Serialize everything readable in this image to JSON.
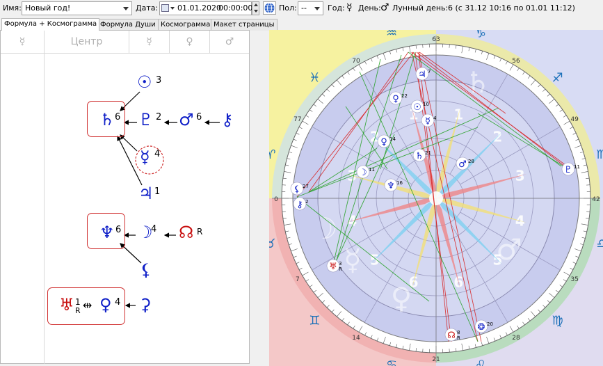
{
  "toolbar": {
    "name_label": "Имя:",
    "name_value": "Новый год!",
    "date_label": "Дата:",
    "date_value": "01.01.2020",
    "time_value": "00:00:00",
    "sex_label": "Пол:",
    "sex_value": "--",
    "year_label": "Год:",
    "year_glyph": "☿",
    "day_label": "День:",
    "day_glyph": "♂",
    "lunar_label": "Лунный день:",
    "lunar_value": "6 (с 31.12 10:16 по 01.01 11:12)"
  },
  "tabs": [
    "Формула + Космограмма",
    "Формула Души",
    "Космограмма",
    "Макет страницы"
  ],
  "formula": {
    "columns": [
      "☿",
      "Центр",
      "☿",
      "♀",
      "♂"
    ],
    "nodes": [
      {
        "glyph": "☉",
        "label": "3"
      },
      {
        "glyph": "♄",
        "label": "6"
      },
      {
        "glyph": "♇",
        "label": "2"
      },
      {
        "glyph": "♂",
        "label": "6"
      },
      {
        "glyph": "⚷",
        "label": ""
      },
      {
        "glyph": "☿",
        "label": "4"
      },
      {
        "glyph": "♃",
        "label": "1"
      },
      {
        "glyph": "♆",
        "label": "6"
      },
      {
        "glyph": "☽",
        "label": "4"
      },
      {
        "glyph": "☊",
        "label": "R"
      },
      {
        "glyph": "⚸",
        "label": ""
      },
      {
        "glyph": "♅",
        "label": "1",
        "sub": "R"
      },
      {
        "glyph": "⇹",
        "label": ""
      },
      {
        "glyph": "♀",
        "label": "4"
      },
      {
        "glyph": "⚳",
        "label": ""
      }
    ]
  },
  "chart": {
    "degree_labels": [
      "63",
      "56",
      "49",
      "42",
      "35",
      "28",
      "21",
      "14",
      "7",
      "0",
      "77",
      "70"
    ],
    "zodiac": [
      "♑",
      "♐",
      "♏",
      "♎",
      "♍",
      "♌",
      "♋",
      "♊",
      "♉",
      "♈",
      "♓",
      "♒"
    ],
    "house_numbers": [
      "1",
      "2",
      "3",
      "4",
      "5",
      "6",
      "6",
      "5",
      "4",
      "3",
      "2",
      "1"
    ],
    "big_glyphs": [
      "☿",
      "♀",
      "♂",
      "♄",
      "☽"
    ],
    "planets": [
      {
        "glyph": "♃",
        "label": "7"
      },
      {
        "glyph": "♀",
        "label": "22"
      },
      {
        "glyph": "☉",
        "label": "10"
      },
      {
        "glyph": "☿",
        "label": "4"
      },
      {
        "glyph": "♀",
        "label": "14"
      },
      {
        "glyph": "♄",
        "label": "21"
      },
      {
        "glyph": "♂",
        "label": "28"
      },
      {
        "glyph": "☽",
        "label": "11"
      },
      {
        "glyph": "♆",
        "label": "16"
      },
      {
        "glyph": "♇",
        "label": "11"
      },
      {
        "glyph": "♅",
        "label": "3",
        "sub": "R"
      },
      {
        "glyph": "☊",
        "label": "8",
        "sub": "R"
      },
      {
        "glyph": "❂",
        "label": "20"
      },
      {
        "glyph": "⚸",
        "label": "27"
      },
      {
        "glyph": "⚷",
        "label": "2"
      }
    ],
    "colors": {
      "red": "#d82020",
      "green": "#22a022",
      "blue_wheel": "#c8ccee",
      "bg_yellow": "#f6f2a0",
      "bg_pink": "#f4c8c8",
      "bg_blue": "#d8dcf4"
    }
  }
}
